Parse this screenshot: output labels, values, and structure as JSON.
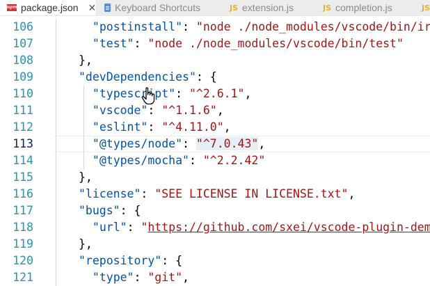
{
  "tabs": [
    {
      "label": "package.json",
      "icon": "npm-icon",
      "active": true,
      "close": "✕"
    },
    {
      "label": "Keyboard Shortcuts",
      "icon": "document-icon",
      "active": false
    },
    {
      "label": "extension.js",
      "icon": "js-icon",
      "active": false
    },
    {
      "label": "completion.js",
      "icon": "js-icon",
      "active": false
    },
    {
      "label": "",
      "icon": "js-icon",
      "active": false
    }
  ],
  "icon_text": {
    "js": "JS",
    "npm": "npm"
  },
  "editor": {
    "current_line": "113",
    "lines": [
      {
        "n": "106",
        "t": [
          [
            "k",
            "\"postinstall\""
          ],
          [
            "p",
            ": "
          ],
          [
            "s",
            "\"node ./node_modules/vscode/bin/ir"
          ]
        ]
      },
      {
        "n": "107",
        "t": [
          [
            "k",
            "\"test\""
          ],
          [
            "p",
            ": "
          ],
          [
            "s",
            "\"node ./node_modules/vscode/bin/test\""
          ]
        ]
      },
      {
        "n": "108",
        "t": [
          [
            "p",
            "},"
          ]
        ]
      },
      {
        "n": "109",
        "t": [
          [
            "k",
            "\"devDependencies\""
          ],
          [
            "p",
            ": {"
          ]
        ]
      },
      {
        "n": "110",
        "t": [
          [
            "k",
            "\"typescript\""
          ],
          [
            "p",
            ": "
          ],
          [
            "s",
            "\"^2.6.1\""
          ],
          [
            "p",
            ","
          ]
        ]
      },
      {
        "n": "111",
        "t": [
          [
            "k",
            "\"vscode\""
          ],
          [
            "p",
            ": "
          ],
          [
            "s",
            "\"^1.1.6\""
          ],
          [
            "p",
            ","
          ]
        ]
      },
      {
        "n": "112",
        "t": [
          [
            "k",
            "\"eslint\""
          ],
          [
            "p",
            ": "
          ],
          [
            "s",
            "\"^4.11.0\""
          ],
          [
            "p",
            ","
          ]
        ]
      },
      {
        "n": "113",
        "t": [
          [
            "k",
            "\"@types/node\""
          ],
          [
            "p",
            ": "
          ],
          [
            "s",
            "\"^7.0.43\""
          ],
          [
            "p",
            ","
          ]
        ]
      },
      {
        "n": "114",
        "t": [
          [
            "k",
            "\"@types/mocha\""
          ],
          [
            "p",
            ": "
          ],
          [
            "s",
            "\"^2.2.42\""
          ]
        ]
      },
      {
        "n": "115",
        "t": [
          [
            "p",
            "},"
          ]
        ]
      },
      {
        "n": "116",
        "t": [
          [
            "k",
            "\"license\""
          ],
          [
            "p",
            ": "
          ],
          [
            "s",
            "\"SEE LICENSE IN LICENSE.txt\""
          ],
          [
            "p",
            ","
          ]
        ]
      },
      {
        "n": "117",
        "t": [
          [
            "k",
            "\"bugs\""
          ],
          [
            "p",
            ": {"
          ]
        ]
      },
      {
        "n": "118",
        "t": [
          [
            "k",
            "\"url\""
          ],
          [
            "p",
            ": "
          ],
          [
            "s",
            "\""
          ],
          [
            "u",
            "https://github.com/sxei/vscode-plugin-dem"
          ]
        ]
      },
      {
        "n": "119",
        "t": [
          [
            "p",
            "},"
          ]
        ]
      },
      {
        "n": "120",
        "t": [
          [
            "k",
            "\"repository\""
          ],
          [
            "p",
            ": {"
          ]
        ]
      },
      {
        "n": "121",
        "t": [
          [
            "k",
            "\"type\""
          ],
          [
            "p",
            ": "
          ],
          [
            "s",
            "\"git\""
          ],
          [
            "p",
            ","
          ]
        ]
      }
    ]
  }
}
